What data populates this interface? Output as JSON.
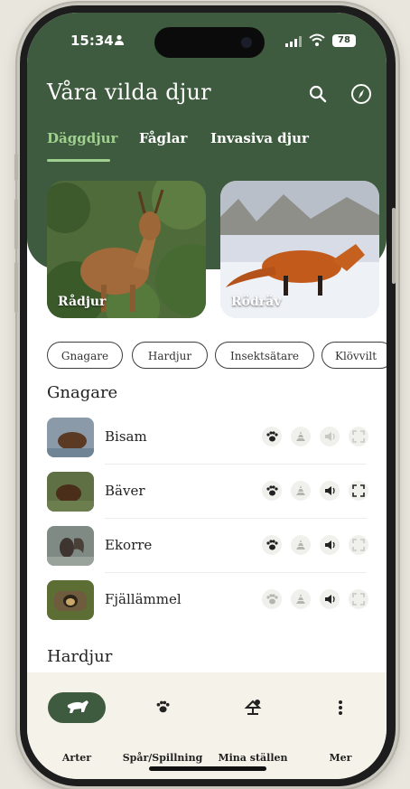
{
  "status_bar": {
    "time": "15:34",
    "battery": "78"
  },
  "header": {
    "title": "Våra vilda djur"
  },
  "tabs": [
    {
      "label": "Däggdjur",
      "active": true
    },
    {
      "label": "Fåglar",
      "active": false
    },
    {
      "label": "Invasiva djur",
      "active": false
    }
  ],
  "featured": [
    {
      "label": "Rådjur"
    },
    {
      "label": "Rödräv"
    }
  ],
  "chips": [
    "Gnagare",
    "Hardjur",
    "Insektsätare",
    "Klövvilt"
  ],
  "sections": [
    {
      "title": "Gnagare",
      "items": [
        {
          "name": "Bisam",
          "icons": [
            "paw-print-icon",
            "droppings-icon",
            "sound-icon",
            "expand-icon"
          ],
          "enabled": [
            true,
            false,
            false,
            false
          ]
        },
        {
          "name": "Bäver",
          "icons": [
            "paw-print-icon",
            "droppings-icon",
            "sound-icon",
            "expand-icon"
          ],
          "enabled": [
            true,
            false,
            true,
            true
          ]
        },
        {
          "name": "Ekorre",
          "icons": [
            "paw-print-icon",
            "droppings-icon",
            "sound-icon",
            "expand-icon"
          ],
          "enabled": [
            true,
            false,
            true,
            false
          ]
        },
        {
          "name": "Fjällämmel",
          "icons": [
            "paw-print-icon",
            "droppings-icon",
            "sound-icon",
            "expand-icon"
          ],
          "enabled": [
            false,
            false,
            true,
            false
          ]
        }
      ]
    },
    {
      "title": "Hardjur",
      "items": []
    }
  ],
  "bottom_nav": [
    {
      "label": "Arter",
      "icon": "animal-icon",
      "active": true
    },
    {
      "label": "Spår/Spillning",
      "icon": "paw-print-icon",
      "active": false
    },
    {
      "label": "Mina ställen",
      "icon": "place-icon",
      "active": false
    },
    {
      "label": "Mer",
      "icon": "more-icon",
      "active": false
    }
  ],
  "colors": {
    "brand_green": "#3f5b3f",
    "active_tab": "#9fd08f",
    "nav_bg": "#f5f2e9"
  }
}
